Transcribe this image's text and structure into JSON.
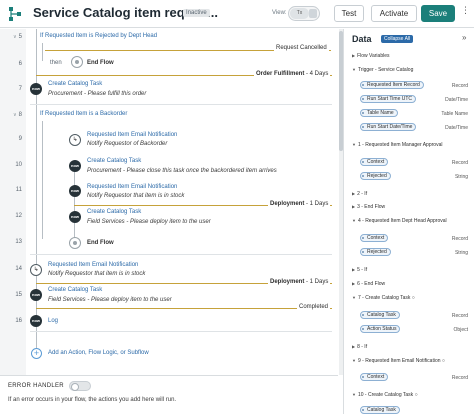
{
  "header": {
    "title": "Service Catalog item reques...",
    "status_badge": "Inactive",
    "view_label": "View:",
    "test_label": "Test",
    "activate_label": "Activate",
    "save_label": "Save"
  },
  "flow": {
    "rows": {
      "r5": "5",
      "r6": "6",
      "r7": "7",
      "r8": "8",
      "r9": "9",
      "r10": "10",
      "r11": "11",
      "r12": "12",
      "r13": "13",
      "r14": "14",
      "r15": "15",
      "r16": "16"
    },
    "if1_prefix": "If",
    "if1_text": "Requested Item is Rejected by Dept Head",
    "stage_request_cancelled": "Request Cancelled",
    "then_label": "then",
    "end_flow": "End Flow",
    "stage_order_fulfillment": "Order Fulfillment",
    "stage_order_fulfillment_days": " - 4 Days",
    "create_catalog_task": "Create Catalog Task",
    "procurement_fulfill": "Procurement - Please fulfill this order",
    "if2_prefix": "If",
    "if2_text": "Requested Item is a Backorder",
    "email_notification": "Requested Item Email Notification",
    "notify_backorder": "Notify Requestor of Backorder",
    "procurement_close": "Procurement - Please close this task once the backordered item arrives",
    "notify_in_stock": "Notify Requestor that item is in stock",
    "stage_deployment": "Deployment",
    "stage_deployment_days": " - 1 Days",
    "field_deploy_user": "Field Services - Please deploy item to the user",
    "field_deploy_user2": "Field Services - Please deploy item to the user",
    "stage_completed": "Completed",
    "log_label": "Log",
    "add_action": "Add an Action, Flow Logic, or Subflow",
    "now_badge": "now"
  },
  "error_handler": {
    "label": "ERROR HANDLER",
    "description": "If an error occurs in your flow, the actions you add here will run."
  },
  "data_panel": {
    "title": "Data",
    "collapse_label": "Collapse All",
    "close_icon": "»",
    "flow_variables": "Flow Variables",
    "trigger": "Trigger - Service Catalog",
    "pills": {
      "requested_item_record": "Requested Item Record",
      "run_start_time_utc": "Run Start Time UTC",
      "table_name": "Table Name",
      "run_start_datetime": "Run Start Date/Time",
      "context1": "Context",
      "rejected1": "Rejected",
      "context2": "Context",
      "rejected2": "Rejected",
      "catalog_task": "Catalog Task",
      "action_status": "Action Status",
      "context3": "Context",
      "catalog_task2": "Catalog Task"
    },
    "types": {
      "record": "Record",
      "datetime": "Date/Time",
      "table_name": "Table Name",
      "datetime2": "Date/Time",
      "record2": "Record",
      "string": "String",
      "record3": "Record",
      "string2": "String",
      "record4": "Record",
      "object": "Object",
      "record5": "Record"
    },
    "sections": {
      "s1": "1 - Requested Item Manager Approval",
      "s2": "2 - If",
      "s3": "3 - End Flow",
      "s4": "4 - Requested Item Dept Head Approval",
      "s5": "5 - If",
      "s6": "6 - End Flow",
      "s7": "7 - Create Catalog Task",
      "s8": "8 - If",
      "s9": "9 - Requested Item Email Notification",
      "s10": "10 - Create Catalog Task"
    }
  }
}
